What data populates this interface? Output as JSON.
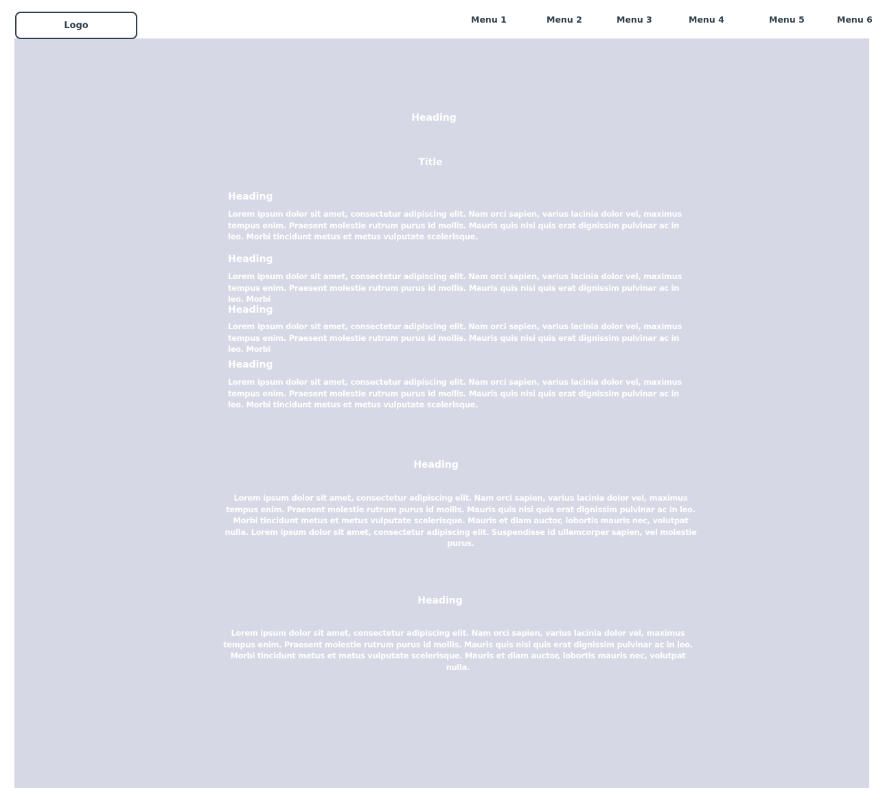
{
  "header": {
    "logo_label": "Logo",
    "menu": [
      "Menu 1",
      "Menu 2",
      "Menu 3",
      "Menu 4",
      "Menu 5",
      "Menu 6"
    ]
  },
  "main": {
    "hero_heading": "Heading",
    "title": "Title",
    "items": [
      {
        "heading": "Heading",
        "text": "Lorem ipsum dolor sit amet, consectetur adipiscing elit. Nam orci sapien, varius lacinia dolor vel, maximus tempus enim. Praesent molestie rutrum purus id mollis. Mauris quis nisi quis erat dignissim pulvinar ac in leo. Morbi tincidunt metus et metus vulputate scelerisque."
      },
      {
        "heading": "Heading",
        "text": "Lorem ipsum dolor sit amet, consectetur adipiscing elit. Nam orci sapien, varius lacinia dolor vel, maximus tempus enim. Praesent molestie rutrum purus id mollis. Mauris quis nisi quis erat dignissim pulvinar ac in leo. Morbi"
      },
      {
        "heading": "Heading",
        "text": "Lorem ipsum dolor sit amet, consectetur adipiscing elit. Nam orci sapien, varius lacinia dolor vel, maximus tempus enim. Praesent molestie rutrum purus id mollis. Mauris quis nisi quis erat dignissim pulvinar ac in leo. Morbi"
      },
      {
        "heading": "Heading",
        "text": "Lorem ipsum dolor sit amet, consectetur adipiscing elit. Nam orci sapien, varius lacinia dolor vel, maximus tempus enim. Praesent molestie rutrum purus id mollis. Mauris quis nisi quis erat dignissim pulvinar ac in leo. Morbi tincidunt metus et metus vulputate scelerisque."
      }
    ],
    "section2": {
      "heading": "Heading",
      "text": "Lorem ipsum dolor sit amet, consectetur adipiscing elit. Nam orci sapien, varius lacinia dolor vel, maximus tempus enim. Praesent molestie rutrum purus id mollis. Mauris quis nisi quis erat dignissim pulvinar ac in leo. Morbi tincidunt metus et metus vulputate scelerisque. Mauris et diam auctor, lobortis mauris nec, volutpat nulla. Lorem ipsum dolor sit amet, consectetur adipiscing elit. Suspendisse id ullamcorper sapien, vel molestie purus."
    },
    "section3": {
      "heading": "Heading",
      "text": "Lorem ipsum dolor sit amet, consectetur adipiscing elit. Nam orci sapien, varius lacinia dolor vel, maximus tempus enim. Praesent molestie rutrum purus id mollis. Mauris quis nisi quis erat dignissim pulvinar ac in leo. Morbi tincidunt metus et metus vulputate scelerisque. Mauris et diam auctor, lobortis mauris nec, volutpat nulla."
    }
  },
  "colors": {
    "canvas_bg": "#d6d8e5",
    "text_dark": "#2f3e4a",
    "text_light": "#ffffff"
  }
}
